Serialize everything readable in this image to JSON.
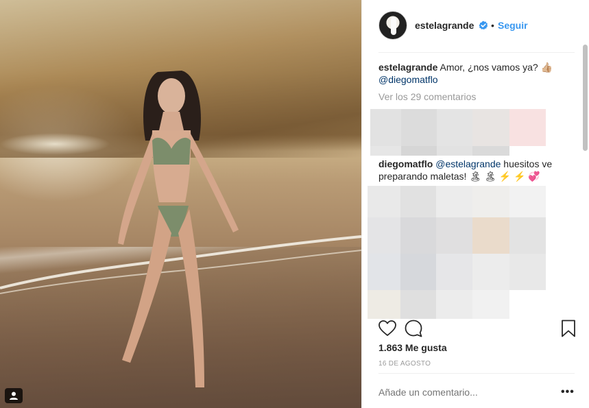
{
  "post": {
    "username": "estelagrande",
    "separator": "•",
    "follow_label": "Seguir",
    "colors": {
      "link": "#3897f0",
      "mention": "#003569",
      "muted": "#999999",
      "text": "#262626"
    }
  },
  "comments": {
    "caption": {
      "author": "estelagrande",
      "text": " Amor, ¿nos vamos ya? 👍🏼",
      "mention": "@diegomatflo"
    },
    "view_all_label": "Ver los 29 comentarios",
    "reply": {
      "author": "diegomatflo",
      "mention": "@estelagrande",
      "text": " huesitos ve preparando maletas! 🏝 🏝 ⚡ ⚡ 💞"
    }
  },
  "stats": {
    "likes": "1.863 Me gusta",
    "date": "16 DE AGOSTO"
  },
  "composer": {
    "placeholder": "Añade un comentario...",
    "more_label": "•••"
  },
  "icons": {
    "verified": "verified-badge-icon",
    "heart": "heart-icon",
    "comment": "comment-icon",
    "bookmark": "bookmark-icon",
    "tagged_people": "tagged-people-icon"
  }
}
